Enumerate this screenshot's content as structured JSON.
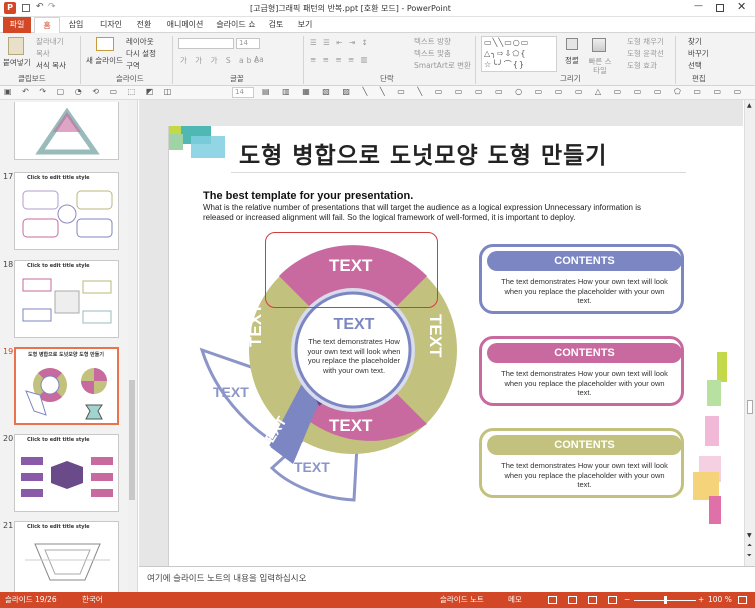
{
  "app": {
    "title": "[고급형]그래픽 패턴의 반복.ppt [호환 모드] - PowerPoint",
    "tabs": [
      "파일",
      "홈",
      "삽입",
      "디자인",
      "전환",
      "애니메이션",
      "슬라이드 쇼",
      "검토",
      "보기"
    ]
  },
  "ribbon": {
    "clipboard": {
      "paste": "붙여넣기",
      "cut": "잘라내기",
      "copy": "복사",
      "format_painter": "서식 복사",
      "label": "클립보드"
    },
    "slides": {
      "new_slide": "새 슬라이드",
      "layout": "레이아웃",
      "reset": "다시 설정",
      "section": "구역",
      "label": "슬라이드"
    },
    "font": {
      "size": "14",
      "label": "글꼴"
    },
    "paragraph": {
      "text_direction": "텍스트 방향",
      "align_text": "텍스트 맞춤",
      "smartart": "SmartArt로 변환",
      "label": "단락"
    },
    "drawing": {
      "arrange": "정렬",
      "quick_styles": "빠른 스타일",
      "fill": "도형 채우기",
      "outline": "도형 윤곽선",
      "effects": "도형 효과",
      "label": "그리기"
    },
    "editing": {
      "find": "찾기",
      "replace": "바꾸기",
      "select": "선택",
      "label": "편집"
    }
  },
  "qat": {
    "font_size": "14"
  },
  "thumbnails": [
    {
      "num": "17",
      "title": "Click to edit title style"
    },
    {
      "num": "18",
      "title": "Click to edit title style"
    },
    {
      "num": "19",
      "title": "도형 병합으로 도넛모양 도형 만들기"
    },
    {
      "num": "20",
      "title": "Click to edit title style"
    },
    {
      "num": "21",
      "title": "Click to edit title style"
    }
  ],
  "slide": {
    "title": "도형 병합으로 도넛모양 도형 만들기",
    "subtitle": "The best template for your presentation.",
    "description": "What is the relative number of presentations that will target the audience as a logical expression Unnecessary information is released or increased alignment will fail. So the logical framework of well-formed, it is important to deploy.",
    "center_title": "TEXT",
    "center_body": "The text demonstrates How your own text will look when you replace the placeholder with your own text.",
    "segments": {
      "top": "TEXT",
      "right": "TEXT",
      "bottom": "TEXT",
      "left": "TEXT",
      "arrow": "TEXT",
      "wedge1": "TEXT",
      "wedge2": "TEXT"
    },
    "contents": [
      {
        "head": "CONTENTS",
        "body": "The text demonstrates How your own text will look when you replace the placeholder with your own text.",
        "color": "#7b86c2"
      },
      {
        "head": "CONTENTS",
        "body": "The text demonstrates How your own text will look when you replace the placeholder with your own text.",
        "color": "#c8699f"
      },
      {
        "head": "CONTENTS",
        "body": "The text demonstrates How your own text will look when you replace the placeholder with your own text.",
        "color": "#c2c27e"
      }
    ]
  },
  "notes": {
    "placeholder": "여기에 슬라이드 노트의 내용을 입력하십시오"
  },
  "status": {
    "slide": "슬라이드 19/26",
    "lang": "한국어",
    "notes_btn": "슬라이드 노트",
    "memo": "메모",
    "zoom": "100 %"
  },
  "colors": {
    "accent": "#d24726",
    "purple": "#7b86c2",
    "pink": "#c8699f",
    "olive": "#c2c27e"
  }
}
